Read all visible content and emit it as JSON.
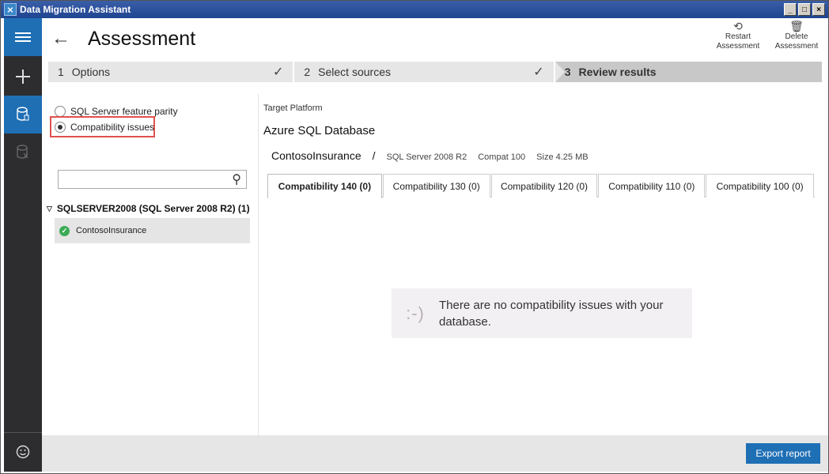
{
  "window": {
    "title": "Data Migration Assistant"
  },
  "sidebar": {
    "items": [
      {
        "name": "menu-icon",
        "glyph": "≡"
      },
      {
        "name": "plus-icon",
        "glyph": "+"
      },
      {
        "name": "database-icon",
        "glyph": "⛁"
      },
      {
        "name": "database-delete-icon",
        "glyph": "⛁"
      },
      {
        "name": "smiley-icon",
        "glyph": "☺"
      }
    ]
  },
  "header": {
    "title": "Assessment",
    "actions": [
      {
        "label1": "Restart",
        "label2": "Assessment",
        "icon": "restart-icon"
      },
      {
        "label1": "Delete",
        "label2": "Assessment",
        "icon": "trash-icon"
      }
    ]
  },
  "steps": [
    {
      "num": "1",
      "label": "Options",
      "done": true
    },
    {
      "num": "2",
      "label": "Select sources",
      "done": true
    },
    {
      "num": "3",
      "label": "Review results",
      "done": false
    }
  ],
  "left": {
    "options": [
      {
        "label": "SQL Server feature parity",
        "selected": false
      },
      {
        "label": "Compatibility issues",
        "selected": true
      }
    ],
    "search": {
      "value": "",
      "placeholder": ""
    },
    "server": "SQLSERVER2008 (SQL Server 2008 R2) (1)",
    "database": "ContosoInsurance"
  },
  "right": {
    "target_label": "Target Platform",
    "target_value": "Azure SQL Database",
    "db_name": "ContosoInsurance",
    "sep": "/",
    "server_version": "SQL Server 2008 R2",
    "compat": "Compat 100",
    "size": "Size 4.25 MB",
    "tabs": [
      "Compatibility 140 (0)",
      "Compatibility 130 (0)",
      "Compatibility 120 (0)",
      "Compatibility 110 (0)",
      "Compatibility 100 (0)"
    ],
    "empty_face": ":-)",
    "empty_message": "There are no compatibility issues with your database."
  },
  "footer": {
    "export_label": "Export report"
  },
  "colors": {
    "accent": "#1f6fb5",
    "sidebar": "#2d2d30",
    "ok": "#3bab56",
    "highlight": "#e0504d"
  }
}
